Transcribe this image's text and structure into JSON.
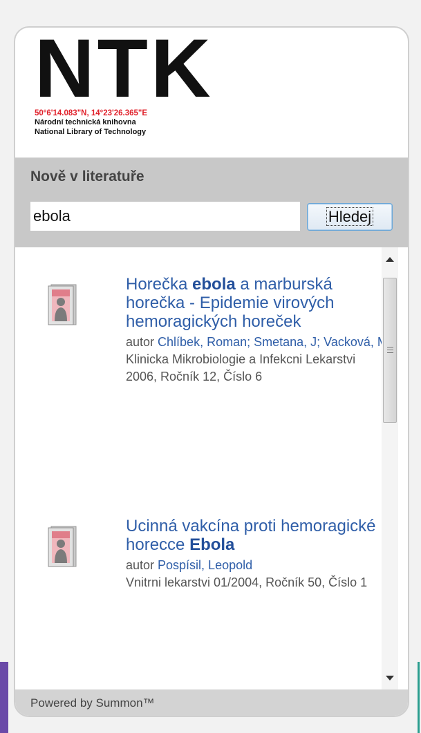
{
  "logo": {
    "name": "NTK",
    "coords": "50°6'14.083\"N, 14°23'26.365\"E",
    "line1": "Národní technická knihovna",
    "line2": "National Library of Technology"
  },
  "search": {
    "heading": "Nově v literatuře",
    "value": "ebola",
    "button_label": "Hledej"
  },
  "results": [
    {
      "title_before": "Horečka ",
      "title_highlight": "ebola",
      "title_after": " a marburská horečka - Epidemie virových hemoragických horeček",
      "author_prefix": "autor ",
      "authors": [
        "Chlíbek, Roman;",
        "Smetana, J;",
        "Vacková, M"
      ],
      "source": "Klinicka Mikrobiologie a Infekcni Lekarstvi 2006, Ročník 12, Číslo 6"
    },
    {
      "title_before": "Ucinná vakcína proti hemoragické horecce ",
      "title_highlight": "Ebola",
      "title_after": "",
      "author_prefix": "autor ",
      "authors": [
        "Pospísil, Leopold"
      ],
      "source": "Vnitrni lekarstvi 01/2004, Ročník 50, Číslo 1"
    }
  ],
  "footer": {
    "text": "Powered by Summon™"
  }
}
